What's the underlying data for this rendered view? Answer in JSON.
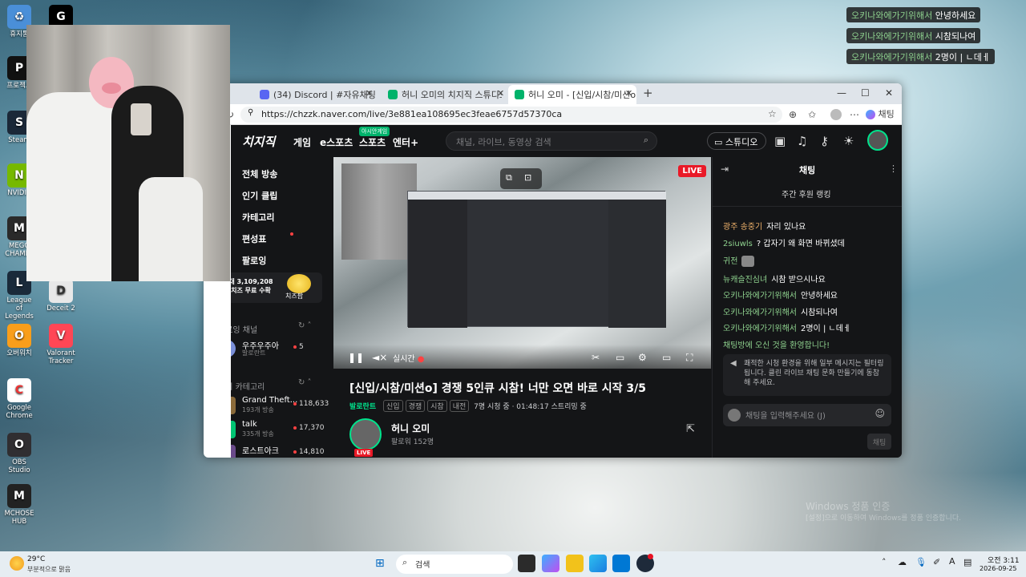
{
  "desktop": {
    "icons": [
      {
        "label": "휴지통",
        "letter": "♻",
        "bg": "#4a8fd8"
      },
      {
        "label": "G HUB",
        "letter": "G",
        "bg": "#000000"
      },
      {
        "label": "프로젝트",
        "letter": "P",
        "bg": "#111111"
      },
      {
        "label": "Steam",
        "letter": "S",
        "bg": "#1b2838"
      },
      {
        "label": "NVIDIA",
        "letter": "N",
        "bg": "#76b900"
      },
      {
        "label": "MEGG CHAMEL",
        "letter": "M",
        "bg": "#2a2a2a"
      },
      {
        "label": "League of Legends",
        "letter": "L",
        "bg": "#1a2a3a"
      },
      {
        "label": "오버워치",
        "letter": "O",
        "bg": "#f99e1a"
      },
      {
        "label": "Google Chrome",
        "letter": "C",
        "bg": "#ffffff"
      },
      {
        "label": "OBS Studio",
        "letter": "O",
        "bg": "#302e31"
      },
      {
        "label": "MCHOSE HUB",
        "letter": "M",
        "bg": "#222222"
      }
    ],
    "extra_icons": [
      {
        "label": "Deceit 2",
        "letter": "D",
        "bg": "#e8e8e8"
      },
      {
        "label": "Valorant Tracker",
        "letter": "V",
        "bg": "#ff4655"
      }
    ],
    "watermark_line1": "Windows 정품 인증",
    "watermark_line2": "[설정]으로 이동하여 Windows를 정품 인증합니다."
  },
  "overlay_chat": [
    {
      "user": "오키나와에가기위해서",
      "msg": "안녕하세요"
    },
    {
      "user": "오키나와에가기위해서",
      "msg": "시참되나여"
    },
    {
      "user": "오키나와에가기위해서",
      "msg": "2명이 | ㄴ데ㅔ"
    }
  ],
  "browser": {
    "tabs": [
      {
        "label": "(34) Discord | #자유채팅 | ...",
        "active": false,
        "color": "#5865f2"
      },
      {
        "label": "허니 오미의 치지직 스튜디오",
        "active": false,
        "color": "#00b36b"
      },
      {
        "label": "허니 오미 - [신입/시참/미션o] 경쟁",
        "active": true,
        "color": "#00b36b"
      }
    ],
    "new_tab": "+",
    "url": "https://chzzk.naver.com/live/3e881ea108695ec3feae6757d57370ca",
    "copilot_label": "채팅"
  },
  "site": {
    "logo": "치지직",
    "nav": [
      "게임",
      "e스포츠",
      "스포츠",
      "엔터+"
    ],
    "nav_badge": "아시안게임",
    "search_placeholder": "채널, 라이브, 동영상 검색",
    "studio_label": "스튜디오",
    "side_menu": [
      "전체 방송",
      "인기 클립",
      "카테고리",
      "편성표",
      "팔로잉"
    ],
    "promo_text": "최대 3,109,208개 치즈 무료 수확",
    "promo_badge": "치즈팜",
    "following_title": "팔로잉 채널",
    "following": [
      {
        "name": "우주우주아",
        "sub": "발로란트",
        "viewers": "5",
        "color": "#7a8fd8"
      }
    ],
    "popular_title": "인기 카테고리",
    "popular": [
      {
        "name": "Grand Theft...",
        "sub": "193개 방송",
        "viewers": "118,633",
        "color": "#8a6a3a"
      },
      {
        "name": "talk",
        "sub": "335개 방송",
        "viewers": "17,370",
        "color": "#00c473"
      },
      {
        "name": "로스트아크",
        "sub": "",
        "viewers": "14,810",
        "color": "#6a4a8a"
      }
    ]
  },
  "player": {
    "live_badge": "LIVE",
    "realtime_label": "실시간"
  },
  "stream": {
    "title": "[신입/시참/미션o] 경쟁 5인큐 시참! 너만 오면 바로 시작 3/5",
    "category": "발로란트",
    "tags": [
      "신입",
      "경쟁",
      "시참",
      "내전"
    ],
    "viewers": "7명 시청 중",
    "uptime": "01:48:17 스트리밍 중",
    "streamer_name": "허니 오미",
    "followers": "팔로워 152명",
    "live_badge": "LIVE"
  },
  "chat": {
    "title": "채팅",
    "ranking": "주간 후원 랭킹",
    "messages": [
      {
        "user": "광주 송중기",
        "msg": "자리 있나요",
        "color": "#f0b26b"
      },
      {
        "user": "2siuwls",
        "msg": "? 갑자기 왜 화면 바뀌셨데",
        "color": "#8ed18e"
      },
      {
        "user": "귀전",
        "msg": "",
        "color": "#8ed18e"
      },
      {
        "user": "뉴캐슬진심녀",
        "msg": "시참 받으시나요",
        "color": "#8ed18e"
      },
      {
        "user": "오키나와에가기위해서",
        "msg": "안녕하세요",
        "color": "#8ed18e"
      },
      {
        "user": "오키나와에가기위해서",
        "msg": "시참되나여",
        "color": "#8ed18e"
      },
      {
        "user": "오키나와에가기위해서",
        "msg": "2명이 | ㄴ데ㅔ",
        "color": "#8ed18e"
      }
    ],
    "welcome": "채팅방에 오신 것을 환영합니다!",
    "notice": "쾌적한 시청 환경을 위해 일부 메시지는 필터링 됩니다. 클린 라이브 채팅 문화 만들기에 동참해 주세요.",
    "input_placeholder": "채팅을 입력해주세요 (J)",
    "send_label": "채팅"
  },
  "taskbar": {
    "weather_temp": "29°C",
    "weather_desc": "부분적으로 맑음",
    "search_label": "검색",
    "time": "오전 3:11",
    "date": "2026-09-25"
  }
}
